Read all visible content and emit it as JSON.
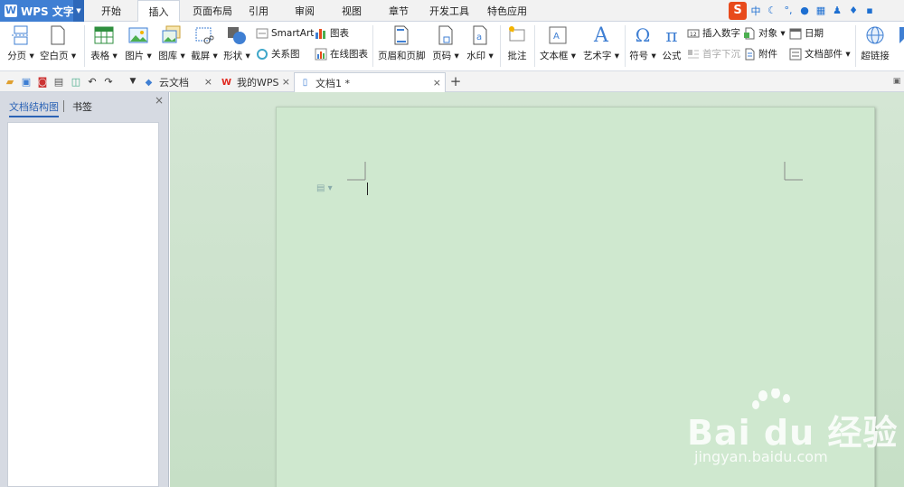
{
  "app": {
    "title": "WPS 文字"
  },
  "menu_tabs": [
    "开始",
    "插入",
    "页面布局",
    "引用",
    "审阅",
    "视图",
    "章节",
    "开发工具",
    "特色应用"
  ],
  "active_menu_tab": "插入",
  "ribbon": {
    "page_break": "分页",
    "blank_page": "空白页",
    "table": "表格",
    "picture": "图片",
    "gallery": "图库",
    "screenshot": "截屏",
    "shape": "形状",
    "smartart": "SmartArt",
    "chart": "图表",
    "relation_chart": "关系图",
    "online_chart": "在线图表",
    "header_footer": "页眉和页脚",
    "page_number": "页码",
    "watermark": "水印",
    "comment": "批注",
    "textbox": "文本框",
    "wordart": "艺术字",
    "symbol": "符号",
    "formula": "公式",
    "insert_number": "插入数字",
    "drop_cap": "首字下沉",
    "object": "对象",
    "attachment": "附件",
    "date": "日期",
    "doc_parts": "文档部件",
    "hyperlink": "超链接"
  },
  "doc_tabs": [
    {
      "label": "云文档",
      "icon": "cloud-icon"
    },
    {
      "label": "我的WPS",
      "icon": "wps-logo-icon"
    },
    {
      "label": "文档1 *",
      "icon": "document-icon"
    }
  ],
  "left_panel": {
    "tab_outline": "文档结构图",
    "tab_bookmark": "书签"
  },
  "watermark": {
    "main": "Bai du 经验",
    "sub": "jingyan.baidu.com"
  },
  "colors": {
    "accent": "#3f7fd3",
    "workspace": "#cfe8cf",
    "sogou": "#e84a1b"
  }
}
